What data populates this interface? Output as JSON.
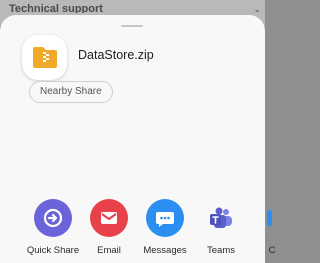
{
  "background": {
    "title": "Technical support"
  },
  "file": {
    "name": "DataStore.zip",
    "icon": "zip-folder-icon"
  },
  "nearby_share": {
    "label": "Nearby Share"
  },
  "apps": [
    {
      "label": "Quick Share",
      "icon": "quick-share-icon",
      "color": "#6b63d9"
    },
    {
      "label": "Email",
      "icon": "email-icon",
      "color": "#e8414a"
    },
    {
      "label": "Messages",
      "icon": "messages-icon",
      "color": "#2a8ff0"
    },
    {
      "label": "Teams",
      "icon": "teams-icon",
      "color": "#5b5fc7"
    },
    {
      "label": "C",
      "icon": "app-icon",
      "color": "#2a8ff0"
    }
  ],
  "colors": {
    "zip_folder": "#f0a928",
    "sheet": "#f8f8f8"
  }
}
